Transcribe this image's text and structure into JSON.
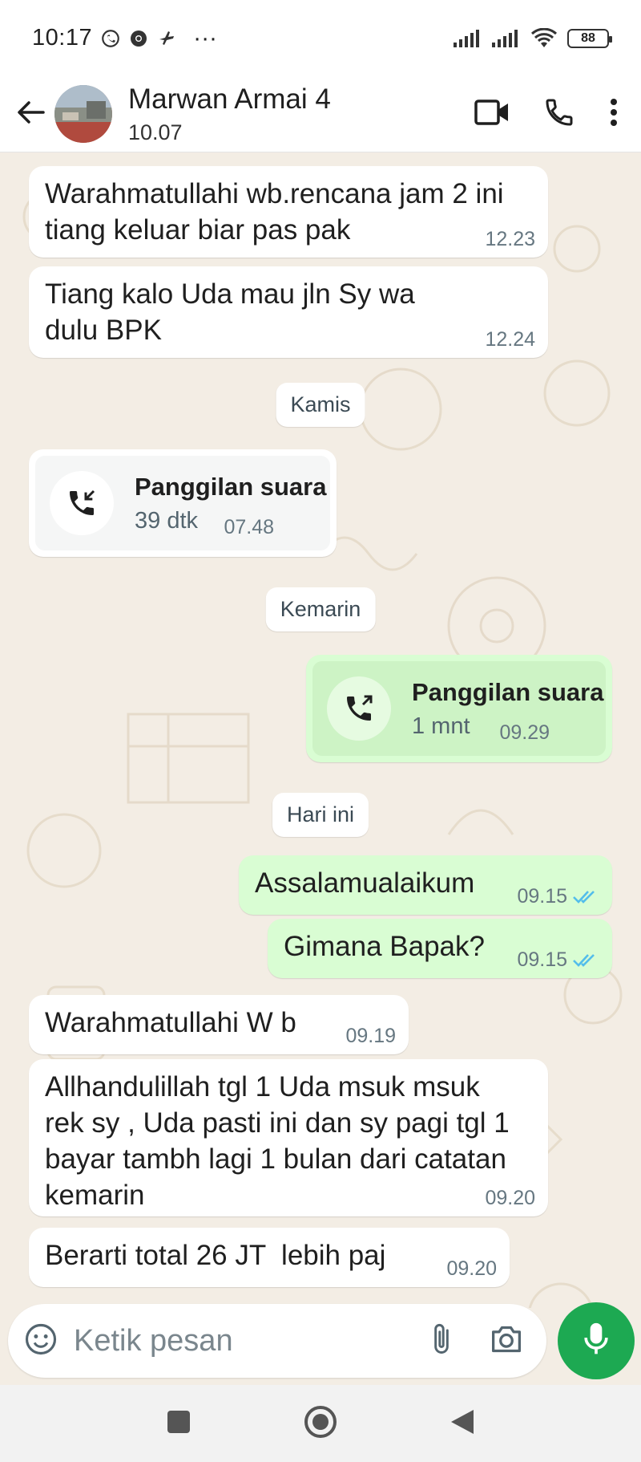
{
  "status_bar": {
    "time": "10:17",
    "overflow": "···",
    "battery": "88"
  },
  "header": {
    "contact_name": "Marwan Armai 4",
    "last_seen": "10.07"
  },
  "messages": [
    {
      "text": "Warahmatullahi wb.rencana jam 2 ini tiang keluar biar pas pak",
      "time": "12.23"
    },
    {
      "text": "Tiang kalo Uda mau jln Sy wa dulu BPK",
      "time": "12.24"
    },
    {
      "day": "Kamis"
    },
    {
      "call_title": "Panggilan suara",
      "call_duration": "39 dtk",
      "time": "07.48"
    },
    {
      "day": "Kemarin"
    },
    {
      "call_title": "Panggilan suara",
      "call_duration": "1 mnt",
      "time": "09.29"
    },
    {
      "day": "Hari ini"
    },
    {
      "text": "Assalamualaikum",
      "time": "09.15"
    },
    {
      "text": "Gimana Bapak?",
      "time": "09.15"
    },
    {
      "text": "Warahmatullahi W b",
      "time": "09.19"
    },
    {
      "text": "Allhandulillah tgl 1 Uda msuk msuk rek sy , Uda pasti ini dan sy pagi tgl 1 bayar tambh lagi 1 bulan dari catatan kemarin",
      "time": "09.20"
    },
    {
      "text": "Berarti total 26 JT  lebih paj",
      "time": "09.20"
    }
  ],
  "input": {
    "placeholder": "Ketik pesan"
  },
  "colors": {
    "outgoing_bubble": "#d9fdd3",
    "incoming_bubble": "#ffffff",
    "chat_background": "#f3ede4",
    "mic_button": "#1da952",
    "read_ticks": "#53bdeb"
  },
  "icons": [
    "whatsapp-icon",
    "chrome-icon",
    "bird-icon",
    "signal-icon",
    "wifi-icon",
    "battery-icon",
    "back-arrow-icon",
    "video-call-icon",
    "phone-icon",
    "more-vert-icon",
    "incoming-call-icon",
    "outgoing-call-icon",
    "read-ticks-icon",
    "emoji-icon",
    "attach-icon",
    "camera-icon",
    "mic-icon",
    "nav-recents-icon",
    "nav-home-icon",
    "nav-back-icon"
  ]
}
